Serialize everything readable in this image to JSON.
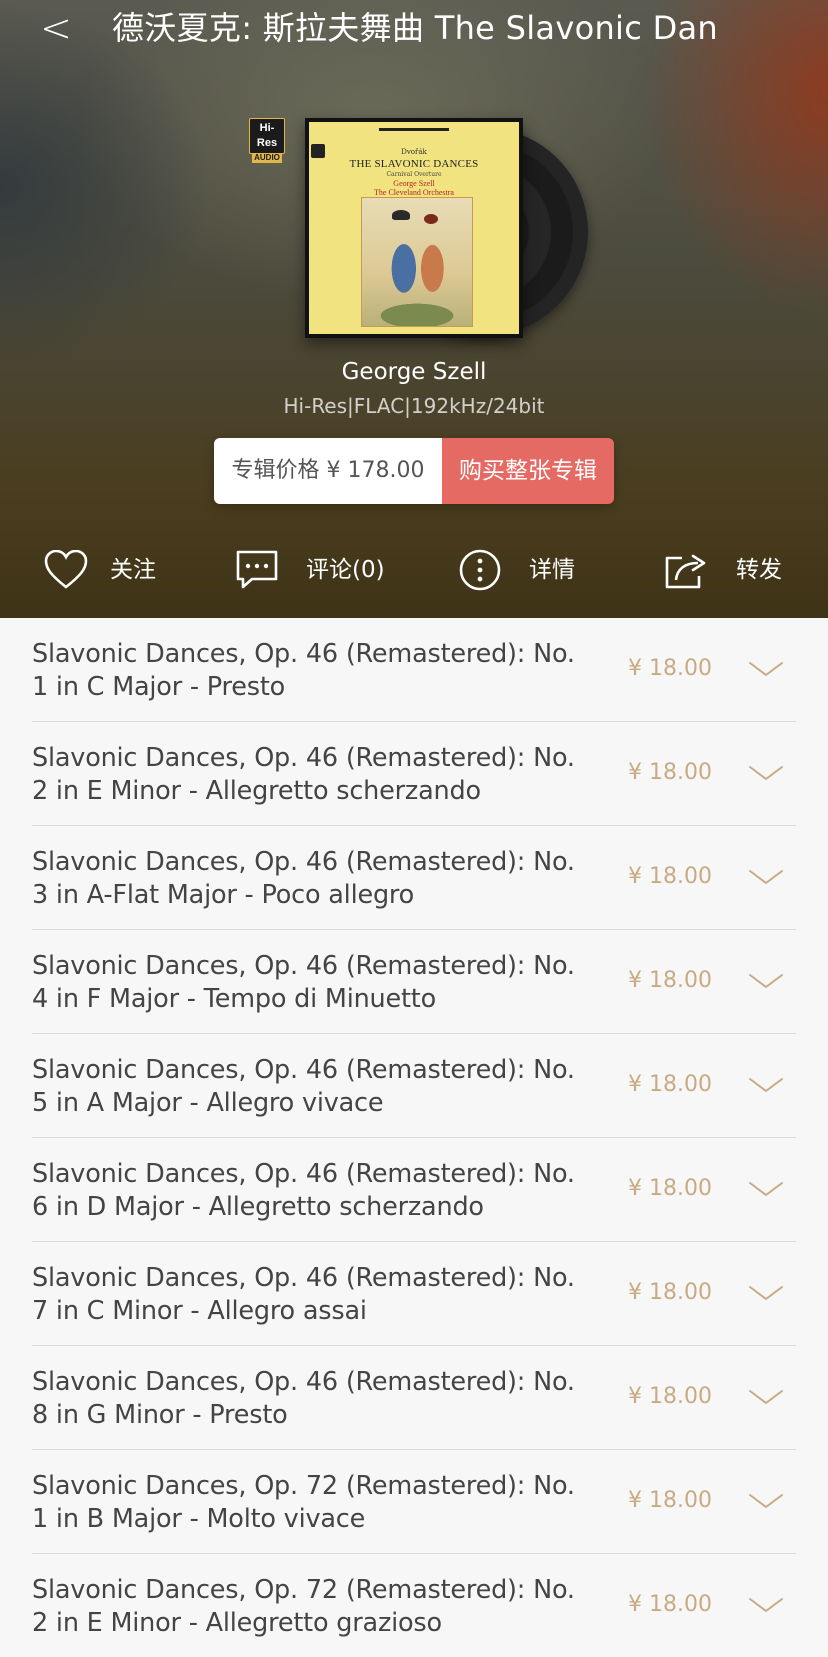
{
  "header": {
    "back_glyph": "<",
    "title": "德沃夏克: 斯拉夫舞曲 The Slavonic Dan"
  },
  "album": {
    "hires_line1": "Hi-Res",
    "hires_line2": "AUDIO",
    "cover_composer": "Dvořák",
    "cover_title": "THE SLAVONIC DANCES",
    "cover_subtitle": "Carnival Overture",
    "cover_conductor": "George Szell",
    "cover_orchestra": "The Cleveland Orchestra",
    "artist": "George Szell",
    "format": "Hi-Res|FLAC|192kHz/24bit"
  },
  "purchase": {
    "price_label": "专辑价格 ¥ 178.00",
    "buy_label": "购买整张专辑",
    "buy_color": "#e56a63"
  },
  "actions": [
    {
      "icon": "heart-icon",
      "label": "关注"
    },
    {
      "icon": "comment-icon",
      "label": "评论(0)"
    },
    {
      "icon": "more-info-icon",
      "label": "详情"
    },
    {
      "icon": "share-icon",
      "label": "转发"
    }
  ],
  "tracks": [
    {
      "title": "Slavonic Dances, Op. 46 (Remastered): No. 1 in C Major - Presto",
      "price": "¥ 18.00"
    },
    {
      "title": "Slavonic Dances, Op. 46 (Remastered): No. 2 in E Minor - Allegretto scherzando",
      "price": "¥ 18.00"
    },
    {
      "title": "Slavonic Dances, Op. 46 (Remastered): No. 3 in A-Flat Major - Poco allegro",
      "price": "¥ 18.00"
    },
    {
      "title": "Slavonic Dances, Op. 46 (Remastered): No. 4 in F Major - Tempo di Minuetto",
      "price": "¥ 18.00"
    },
    {
      "title": "Slavonic Dances, Op. 46 (Remastered): No. 5 in A Major - Allegro vivace",
      "price": "¥ 18.00"
    },
    {
      "title": "Slavonic Dances, Op. 46 (Remastered): No. 6 in D Major - Allegretto scherzando",
      "price": "¥ 18.00"
    },
    {
      "title": "Slavonic Dances, Op. 46 (Remastered): No. 7 in C Minor - Allegro assai",
      "price": "¥ 18.00"
    },
    {
      "title": "Slavonic Dances, Op. 46 (Remastered): No. 8 in G Minor - Presto",
      "price": "¥ 18.00"
    },
    {
      "title": "Slavonic Dances, Op. 72 (Remastered): No. 1 in B Major - Molto vivace",
      "price": "¥ 18.00"
    },
    {
      "title": "Slavonic Dances, Op. 72 (Remastered): No. 2 in E Minor - Allegretto grazioso",
      "price": "¥ 18.00"
    }
  ],
  "colors": {
    "price_text": "#c9ab83",
    "track_text": "#444444",
    "divider": "#dcdcdc"
  }
}
